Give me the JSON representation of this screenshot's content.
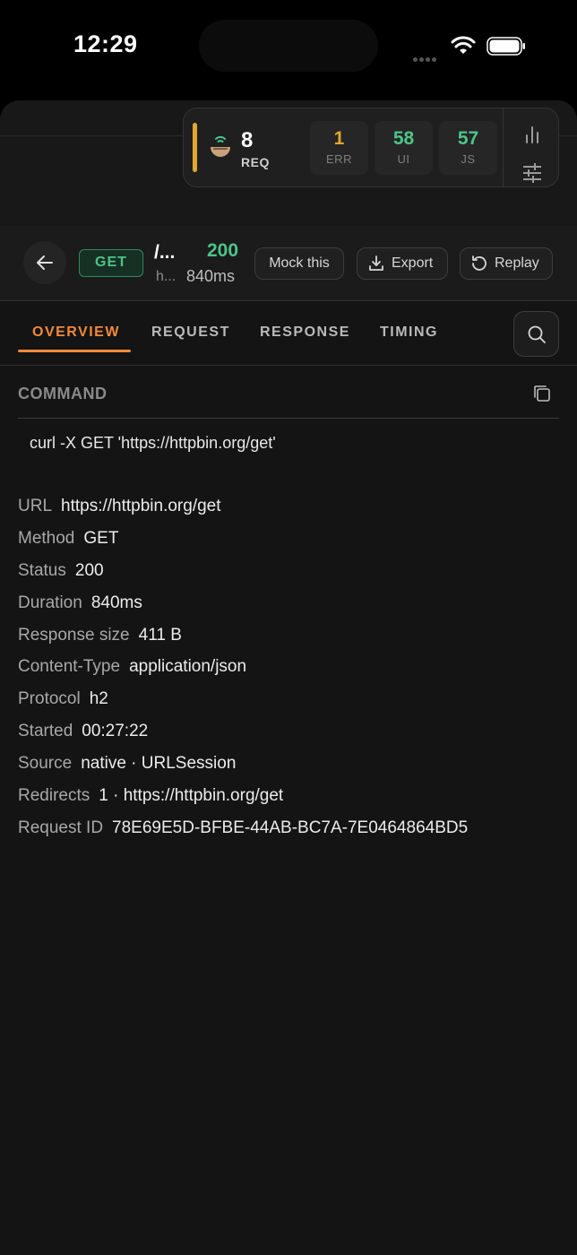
{
  "status_bar": {
    "time": "12:29"
  },
  "widget": {
    "request_count": "8",
    "request_label": "REQ",
    "tiles": [
      {
        "value": "1",
        "label": "ERR",
        "color": "#e3a72f"
      },
      {
        "value": "58",
        "label": "UI",
        "color": "#4cc48a"
      },
      {
        "value": "57",
        "label": "JS",
        "color": "#4cc48a"
      }
    ],
    "accent_color": "#e3a72f"
  },
  "request": {
    "method": "GET",
    "path": "/...",
    "host": "h...",
    "status": "200",
    "duration": "840ms",
    "actions": {
      "mock": "Mock this",
      "export": "Export",
      "replay": "Replay"
    }
  },
  "tabs": [
    {
      "label": "OVERVIEW",
      "active": true
    },
    {
      "label": "REQUEST",
      "active": false
    },
    {
      "label": "RESPONSE",
      "active": false
    },
    {
      "label": "TIMING",
      "active": false
    }
  ],
  "command": {
    "heading": "COMMAND",
    "text": "curl -X GET 'https://httpbin.org/get'"
  },
  "details": [
    {
      "key": "URL",
      "value": "https://httpbin.org/get"
    },
    {
      "key": "Method",
      "value": "GET"
    },
    {
      "key": "Status",
      "value": "200"
    },
    {
      "key": "Duration",
      "value": "840ms"
    },
    {
      "key": "Response size",
      "value": "411 B"
    },
    {
      "key": "Content-Type",
      "value": "application/json"
    },
    {
      "key": "Protocol",
      "value": "h2"
    },
    {
      "key": "Started",
      "value": "00:27:22"
    },
    {
      "key": "Source",
      "value": "native · URLSession"
    },
    {
      "key": "Redirects",
      "value": "1 · https://httpbin.org/get"
    },
    {
      "key": "Request ID",
      "value": "78E69E5D-BFBE-44AB-BC7A-7E0464864BD5"
    }
  ],
  "colors": {
    "accent": "#f08a3a",
    "success": "#4cc48a",
    "warning": "#e3a72f"
  },
  "icons": [
    "wifi-icon",
    "battery-icon",
    "network-inspector-icon",
    "bar-chart-icon",
    "sliders-icon",
    "back-arrow-icon",
    "download-icon",
    "replay-icon",
    "search-icon",
    "copy-icon"
  ]
}
